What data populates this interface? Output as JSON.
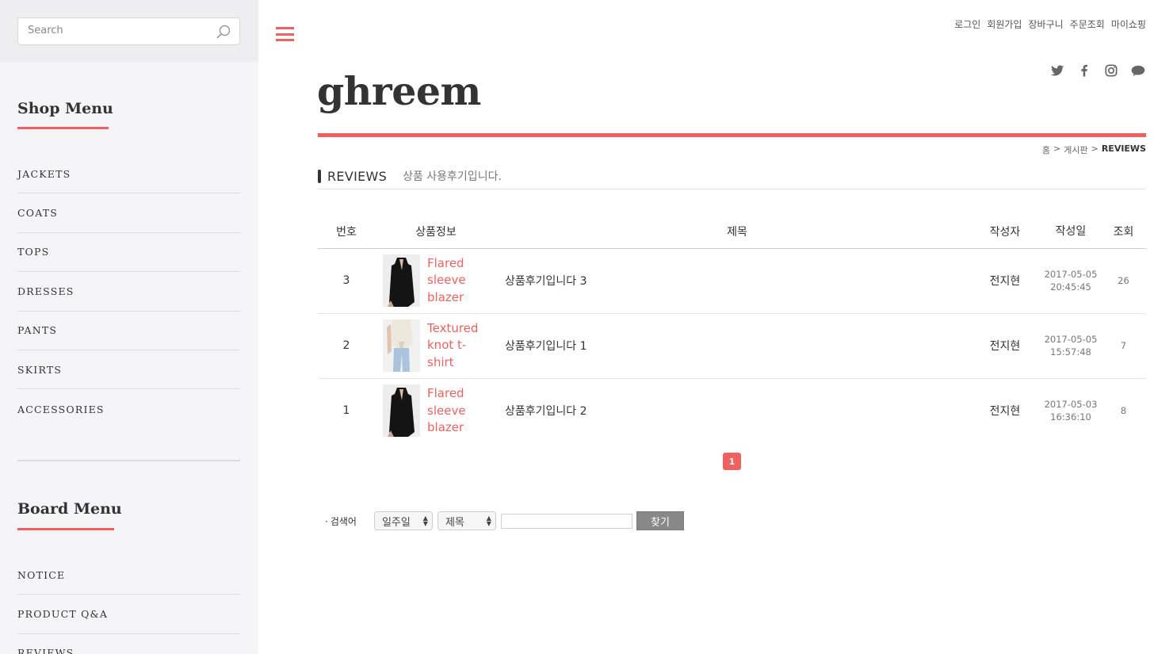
{
  "search": {
    "placeholder": "Search"
  },
  "shop_menu": {
    "heading": "Shop Menu",
    "items": [
      "JACKETS",
      "COATS",
      "TOPS",
      "DRESSES",
      "PANTS",
      "SKIRTS",
      "ACCESSORIES"
    ]
  },
  "board_menu": {
    "heading": "Board Menu",
    "items": [
      "NOTICE",
      "PRODUCT Q&A",
      "REVIEWS"
    ]
  },
  "top_links": [
    "로그인",
    "회원가입",
    "장바구니",
    "주문조회",
    "마이쇼핑"
  ],
  "social_icons": [
    "twitter-icon",
    "facebook-icon",
    "instagram-icon",
    "chat-bubble-icon"
  ],
  "logo": "ghreem",
  "breadcrumb": {
    "home": "홈",
    "sep": ">",
    "board": "게시판",
    "current": "REVIEWS"
  },
  "board": {
    "name": "REVIEWS",
    "description": "상품 사용후기입니다."
  },
  "table": {
    "headers": {
      "num": "번호",
      "product": "상품정보",
      "subject": "제목",
      "writer": "작성자",
      "date": "작성일",
      "views": "조회"
    },
    "rows": [
      {
        "num": "3",
        "product": "Flared sleeve blazer",
        "subject": "상품후기입니다 3",
        "writer": "전지현",
        "date": "2017-05-05",
        "time": "20:45:45",
        "views": "26",
        "thumb": "black-blazer"
      },
      {
        "num": "2",
        "product": "Textured knot t-shirt",
        "subject": "상품후기입니다 1",
        "writer": "전지현",
        "date": "2017-05-05",
        "time": "15:57:48",
        "views": "7",
        "thumb": "knot-tshirt"
      },
      {
        "num": "1",
        "product": "Flared sleeve blazer",
        "subject": "상품후기입니다 2",
        "writer": "전지현",
        "date": "2017-05-03",
        "time": "16:36:10",
        "views": "8",
        "thumb": "black-blazer"
      }
    ]
  },
  "pagination": {
    "current": "1"
  },
  "search_form": {
    "label": "검색어",
    "period": "일주일",
    "field": "제목",
    "keyword": "",
    "button": "찾기"
  },
  "colors": {
    "accent": "#f0605f",
    "sidebar_bg": "#f5f5f7",
    "button_gray": "#888888"
  }
}
